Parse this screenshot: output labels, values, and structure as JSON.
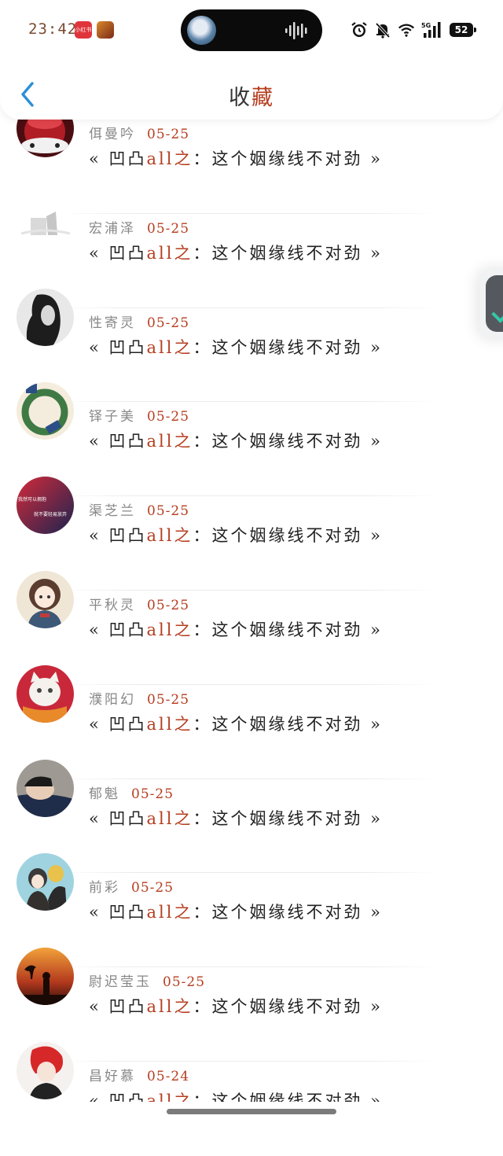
{
  "status_bar": {
    "time": "23:42",
    "mini_app_label": "小红书",
    "battery": "52"
  },
  "header": {
    "title_part1": "收",
    "title_part2": "藏"
  },
  "book_title": {
    "prefix": "« 凹凸",
    "highlight": "all之",
    "suffix": "：这个姻缘线不对劲 »"
  },
  "items": [
    {
      "name": "佴曼吟",
      "date": "05-25"
    },
    {
      "name": "宏浦泽",
      "date": "05-25"
    },
    {
      "name": "性寄灵",
      "date": "05-25"
    },
    {
      "name": "铎子美",
      "date": "05-25"
    },
    {
      "name": "渠芝兰",
      "date": "05-25"
    },
    {
      "name": "平秋灵",
      "date": "05-25"
    },
    {
      "name": "濮阳幻",
      "date": "05-25"
    },
    {
      "name": "郁魁",
      "date": "05-25"
    },
    {
      "name": "前彩",
      "date": "05-25"
    },
    {
      "name": "尉迟莹玉",
      "date": "05-25"
    },
    {
      "name": "昌好慕",
      "date": "05-24"
    }
  ],
  "avatar_texts": {
    "item5_line1": "我然可以拥抱",
    "item5_line2": "就不要轻易放弃"
  },
  "colors": {
    "accent": "#b53d1f",
    "text": "#222222",
    "meta": "#888888"
  }
}
